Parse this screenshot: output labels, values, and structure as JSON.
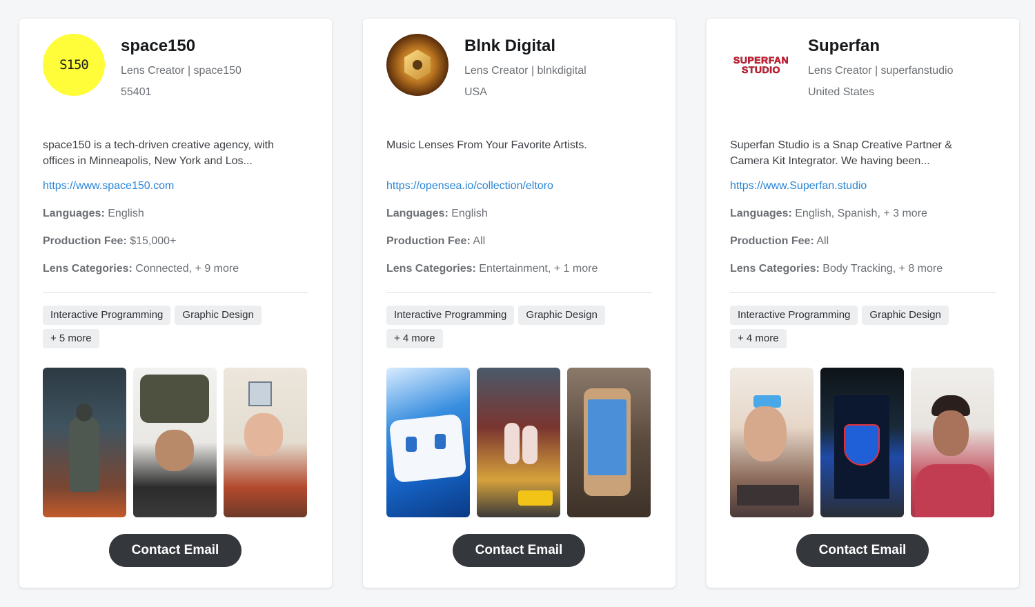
{
  "cards": [
    {
      "name": "space150",
      "role": "Lens Creator | space150",
      "location": "55401",
      "avatar_text": "S150",
      "avatar_color": "#fffc3a",
      "description_line1": "space150 is a tech-driven creative agency, with",
      "description_line2": "offices in Minneapolis, New York and Los...",
      "url": "https://www.space150.com",
      "languages_label": "Languages:",
      "languages": "English",
      "fee_label": "Production Fee:",
      "fee": "$15,000+",
      "categories_label": "Lens Categories:",
      "categories": "Connected, + 9 more",
      "tags": [
        "Interactive Programming",
        "Graphic Design",
        "+ 5 more"
      ],
      "contact_label": "Contact Email"
    },
    {
      "name": "Blnk Digital",
      "role": "Lens Creator | blnkdigital",
      "location": "USA",
      "description_line1": "Music Lenses From Your Favorite Artists.",
      "description_line2": "",
      "url": "https://opensea.io/collection/eltoro",
      "languages_label": "Languages:",
      "languages": "English",
      "fee_label": "Production Fee:",
      "fee": "All",
      "categories_label": "Lens Categories:",
      "categories": "Entertainment, + 1 more",
      "tags": [
        "Interactive Programming",
        "Graphic Design",
        "+ 4 more"
      ],
      "contact_label": "Contact Email"
    },
    {
      "name": "Superfan",
      "role": "Lens Creator | superfanstudio",
      "location": "United States",
      "logo_line1": "SUPERFAN",
      "logo_line2": "STUDIO",
      "description_line1": "Superfan Studio is a Snap Creative Partner &",
      "description_line2": "Camera Kit Integrator. We having been...",
      "url": "https://www.Superfan.studio",
      "languages_label": "Languages:",
      "languages": "English, Spanish, + 3 more",
      "fee_label": "Production Fee:",
      "fee": "All",
      "categories_label": "Lens Categories:",
      "categories": "Body Tracking, + 8 more",
      "tags": [
        "Interactive Programming",
        "Graphic Design",
        "+ 4 more"
      ],
      "contact_label": "Contact Email"
    }
  ],
  "colors": {
    "link": "#2b85d6",
    "button": "#34373b",
    "tag_bg": "#eceef0"
  }
}
